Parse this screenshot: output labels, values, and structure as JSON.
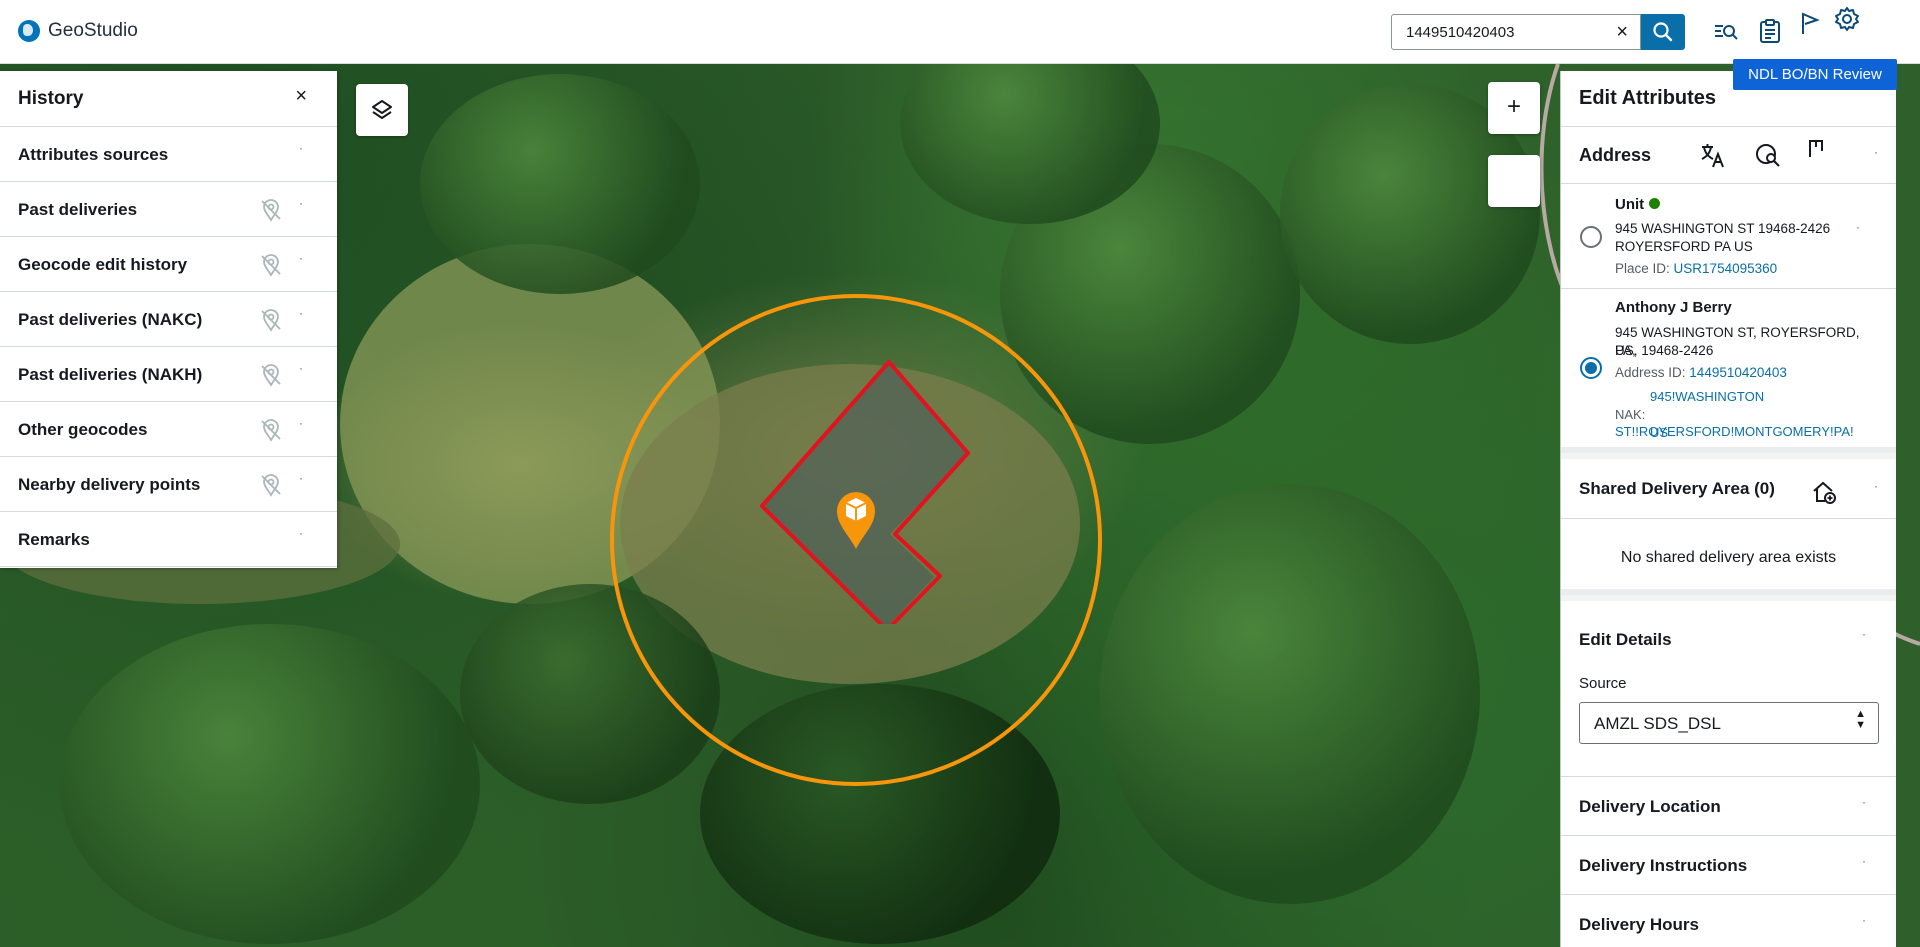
{
  "app": {
    "title": "GeoStudio"
  },
  "search": {
    "value": "1449510420403",
    "clear_icon": "×"
  },
  "review_button": "NDL BO/BN Review",
  "map": {
    "zoom_in": "+",
    "colors": {
      "circle": "#f7950b",
      "building": "#e0141e",
      "marker": "#f7950b"
    }
  },
  "history": {
    "title": "History",
    "close": "×",
    "items": [
      {
        "label": "Attributes sources",
        "pin_off": false
      },
      {
        "label": "Past deliveries",
        "pin_off": true
      },
      {
        "label": "Geocode edit history",
        "pin_off": true
      },
      {
        "label": "Past deliveries (NAKC)",
        "pin_off": true
      },
      {
        "label": "Past deliveries (NAKH)",
        "pin_off": true
      },
      {
        "label": "Other geocodes",
        "pin_off": true
      },
      {
        "label": "Nearby delivery points",
        "pin_off": true
      },
      {
        "label": "Remarks",
        "pin_off": false
      }
    ]
  },
  "edit": {
    "title": "Edit Attributes",
    "close": "×",
    "address": {
      "title": "Address",
      "unit": {
        "title": "Unit",
        "line1": "945 WASHINGTON ST 19468-2426",
        "line2": "ROYERSFORD PA US",
        "place_id_label": "Place ID:",
        "place_id": "USR1754095360",
        "selected": false
      },
      "berry": {
        "title": "Anthony J Berry",
        "line1": "945 WASHINGTON ST, ROYERSFORD, PA,",
        "line2": "US, 19468-2426",
        "address_id_label": "Address ID:",
        "address_id": "1449510420403",
        "nak_label": "NAK:",
        "nak_line1": "945!WASHINGTON",
        "nak_line2": "ST!!ROYERSFORD!MONTGOMERY!PA!",
        "nak_line3": "US",
        "selected": true
      }
    },
    "shared_delivery_area": {
      "title": "Shared Delivery Area (0)",
      "empty_text": "No shared delivery area exists"
    },
    "edit_details": {
      "title": "Edit Details",
      "source_label": "Source",
      "source_value": "AMZL SDS_DSL"
    },
    "collapsed_sections": [
      {
        "title": "Delivery Location"
      },
      {
        "title": "Delivery Instructions"
      },
      {
        "title": "Delivery Hours"
      }
    ]
  }
}
